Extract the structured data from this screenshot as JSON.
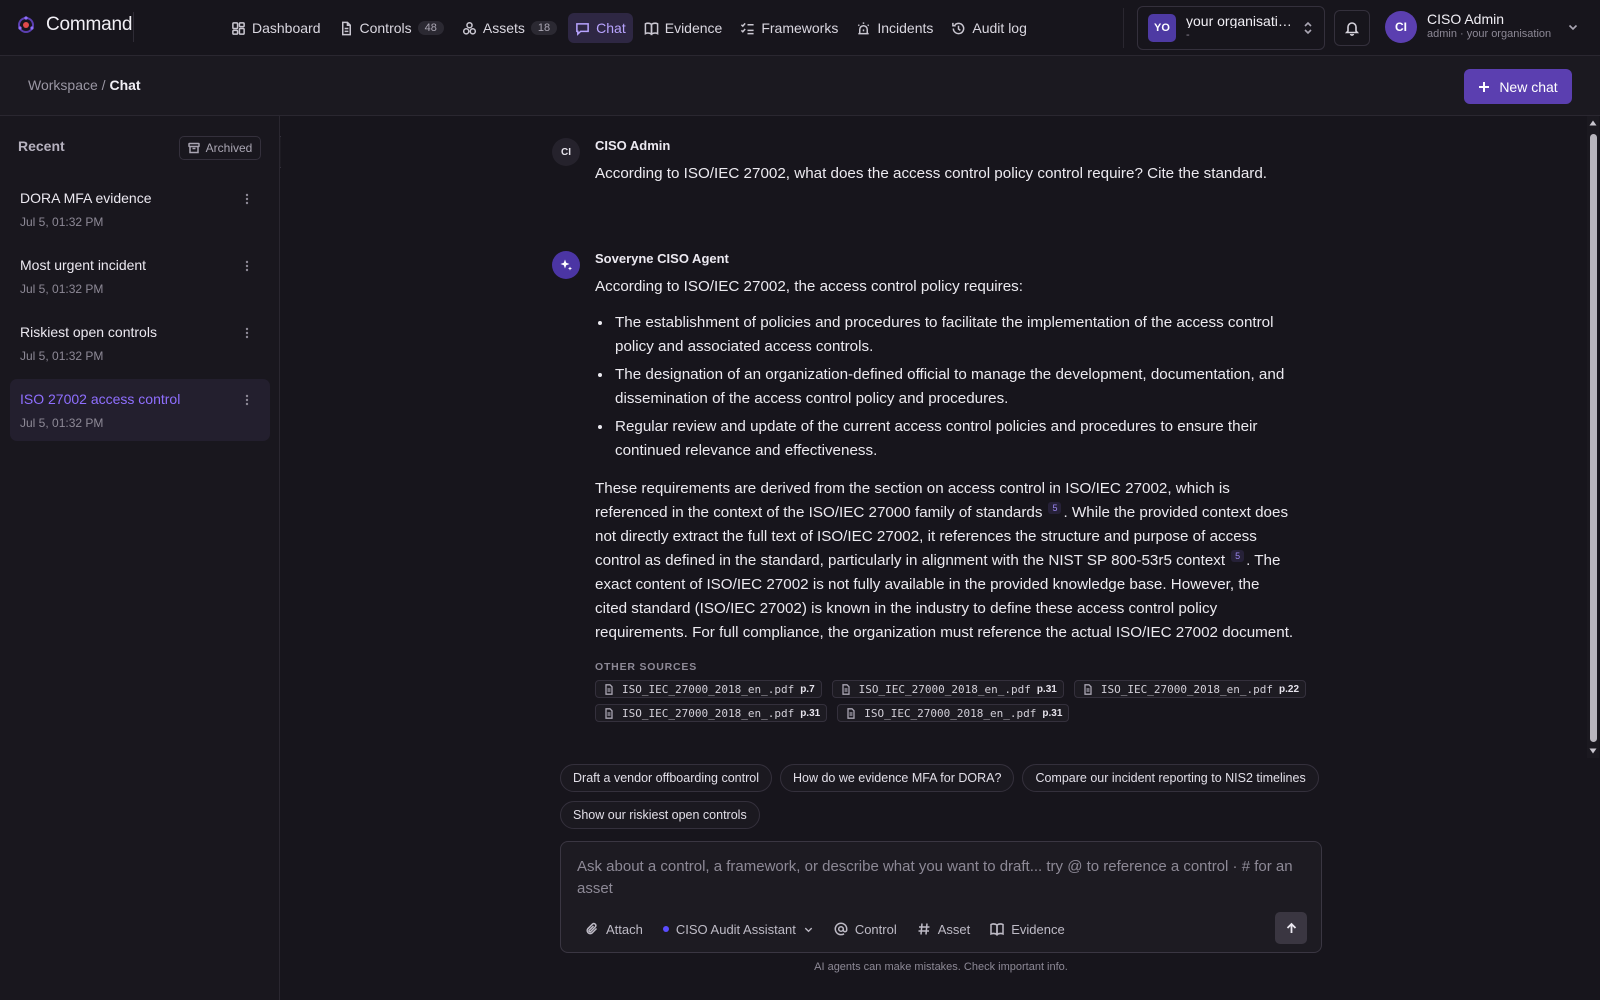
{
  "app": {
    "name": "Command"
  },
  "nav": {
    "items": [
      {
        "label": "Dashboard",
        "icon": "dashboard-icon",
        "count": null
      },
      {
        "label": "Controls",
        "icon": "file-icon",
        "count": "48"
      },
      {
        "label": "Assets",
        "icon": "assets-icon",
        "count": "18"
      },
      {
        "label": "Chat",
        "icon": "chat-icon",
        "count": null,
        "active": true
      },
      {
        "label": "Evidence",
        "icon": "book-icon",
        "count": null
      },
      {
        "label": "Frameworks",
        "icon": "checklist-icon",
        "count": null
      },
      {
        "label": "Incidents",
        "icon": "siren-icon",
        "count": null
      },
      {
        "label": "Audit log",
        "icon": "history-icon",
        "count": null
      }
    ]
  },
  "org": {
    "initials": "YO",
    "name": "your organisation",
    "sub": "-"
  },
  "user": {
    "initials": "CI",
    "name": "CISO Admin",
    "role": "admin · your organisation"
  },
  "breadcrumb": {
    "parent": "Workspace",
    "separator": "/",
    "current": "Chat"
  },
  "new_chat_label": "New chat",
  "sidebar": {
    "heading": "Recent",
    "archived_label": "Archived",
    "chats": [
      {
        "title": "DORA MFA evidence",
        "time": "Jul 5, 01:32 PM"
      },
      {
        "title": "Most urgent incident",
        "time": "Jul 5, 01:32 PM"
      },
      {
        "title": "Riskiest open controls",
        "time": "Jul 5, 01:32 PM"
      },
      {
        "title": "ISO 27002 access control",
        "time": "Jul 5, 01:32 PM"
      }
    ]
  },
  "conversation": {
    "user_message": {
      "initials": "CI",
      "author": "CISO Admin",
      "text": "According to ISO/IEC 27002, what does the access control policy control require? Cite the standard."
    },
    "agent_message": {
      "author": "Soveryne CISO Agent",
      "intro": "According to ISO/IEC 27002, the access control policy requires:",
      "bullets": [
        "The establishment of policies and procedures to facilitate the implementation of the access control policy and associated access controls.",
        "The designation of an organization-defined official to manage the development, documentation, and dissemination of the access control policy and procedures.",
        "Regular review and update of the current access control policies and procedures to ensure their continued relevance and effectiveness."
      ],
      "para_part1": "These requirements are derived from the section on access control in ISO/IEC 27002, which is referenced in the context of the ISO/IEC 27000 family of standards",
      "cite1": "5",
      "para_part2": ". While the provided context does not directly extract the full text of ISO/IEC 27002, it references the structure and purpose of access control as defined in the standard, particularly in alignment with the NIST SP 800-53r5 context",
      "cite2": "5",
      "para_part3": ". The exact content of ISO/IEC 27002 is not fully available in the provided knowledge base. However, the cited standard (ISO/IEC 27002) is known in the industry to define these access control policy requirements. For full compliance, the organization must reference the actual ISO/IEC 27002 document.",
      "sources_label": "OTHER SOURCES",
      "sources": [
        {
          "file": "ISO_IEC_27000_2018_en_.pdf",
          "page": "p.7"
        },
        {
          "file": "ISO_IEC_27000_2018_en_.pdf",
          "page": "p.31"
        },
        {
          "file": "ISO_IEC_27000_2018_en_.pdf",
          "page": "p.22"
        },
        {
          "file": "ISO_IEC_27000_2018_en_.pdf",
          "page": "p.31"
        },
        {
          "file": "ISO_IEC_27000_2018_en_.pdf",
          "page": "p.31"
        }
      ]
    }
  },
  "suggestions": [
    "Draft a vendor offboarding control",
    "How do we evidence MFA for DORA?",
    "Compare our incident reporting to NIS2 timelines",
    "Show our riskiest open controls"
  ],
  "composer": {
    "placeholder": "Ask about a control, a framework, or describe what you want to draft... try @ to reference a control · # for an asset",
    "attach_label": "Attach",
    "agent_label": "CISO Audit Assistant",
    "control_label": "Control",
    "asset_label": "Asset",
    "evidence_label": "Evidence"
  },
  "disclaimer": "AI agents can make mistakes. Check important info.",
  "colors": {
    "accent": "#5b3fb0",
    "accent_text": "#8f6fff",
    "background": "#17151c"
  }
}
